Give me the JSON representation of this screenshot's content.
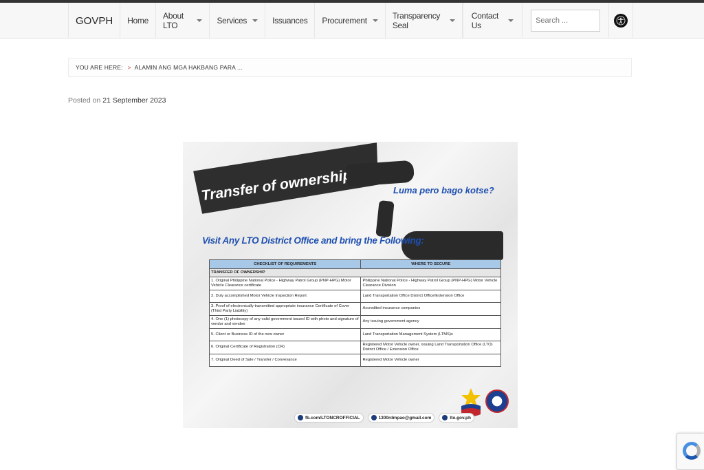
{
  "nav": {
    "brand": "GOVPH",
    "items": [
      {
        "label": "Home",
        "dropdown": false
      },
      {
        "label": "About LTO",
        "dropdown": true
      },
      {
        "label": "Services",
        "dropdown": true
      },
      {
        "label": "Issuances",
        "dropdown": false
      },
      {
        "label": "Procurement",
        "dropdown": true
      },
      {
        "label": "Transparency Seal",
        "dropdown": true
      }
    ],
    "contact": "Contact Us",
    "search_placeholder": "Search ..."
  },
  "breadcrumb": {
    "label": "YOU ARE HERE:",
    "current": "ALAMIN ANG MGA HAKBANG PARA ..."
  },
  "post": {
    "posted_prefix": "Posted on",
    "date": "21 September 2023"
  },
  "poster": {
    "title": "Transfer of ownership",
    "tagline": "Luma pero bago kotse?",
    "instruction": "Visit Any LTO District Office and bring the Following:",
    "table": {
      "headers": [
        "CHECKLIST OF REQUIREMENTS",
        "WHERE TO SECURE"
      ],
      "section": "TRANSFER OF OWNERSHIP",
      "rows": [
        [
          "1. Original Philippine National Police - Highway Patrol Group (PNP-HPG) Motor Vehicle Clearance certificate",
          "Philippine National Police - Highway Patrol Group (PNP-HPG) Motor Vehicle Clearance Division"
        ],
        [
          "2. Duly accomplished Motor Vehicle Inspection Report",
          "Land Transportation Office District Office/Extension Office"
        ],
        [
          "3. Proof of electronically transmitted appropriate insurance Certificate of Cover (Third Party Liability)",
          "Accredited insurance companies"
        ],
        [
          "4. One (1) photocopy of any valid government issued ID with photo and signature of vendor and vendee",
          "Any issuing government agency"
        ],
        [
          "5. Client or Business ID of the new owner",
          "Land Transportation Management System (LTMS)s"
        ],
        [
          "6. Original Certificate of Registration (CR)",
          "Registered Motor Vehicle owner, issuing Land Transportation Office (LTO) District Office / Extension Office"
        ],
        [
          "7. Original Deed of Sale / Transfer / Conveyance",
          "Registered Motor Vehicle owner"
        ]
      ]
    },
    "links": {
      "facebook": "fb.com/LTONCROFFICIAL",
      "email": "1300rdmpao@gmail.com",
      "web": "lto.gov.ph"
    }
  },
  "colors": {
    "accent_blue": "#1e4fb0",
    "table_header": "#a8c8e8",
    "nav_bg": "#f7f7f7"
  }
}
